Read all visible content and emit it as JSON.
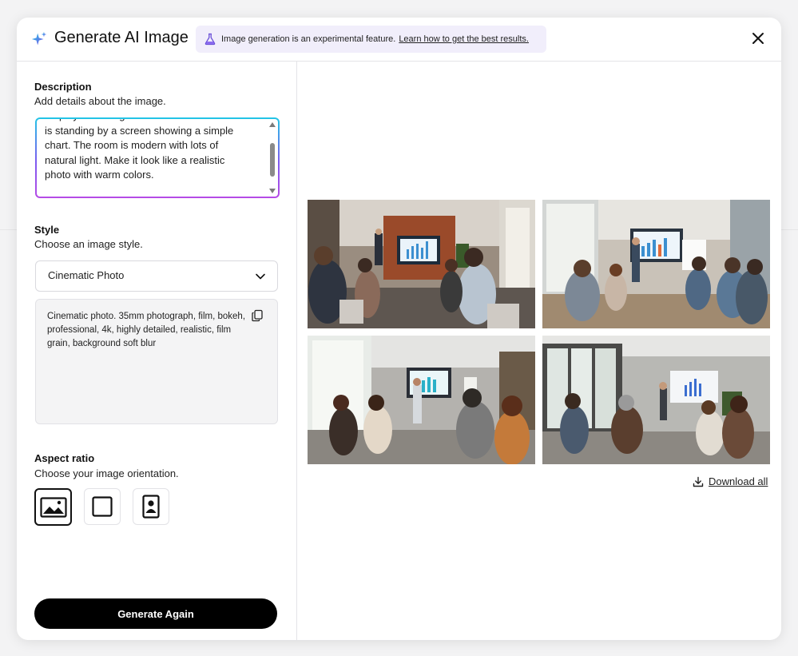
{
  "header": {
    "title": "Generate AI Image",
    "banner_text": "Image generation is an experimental feature.",
    "banner_link": "Learn how to get the best results."
  },
  "description": {
    "title": "Description",
    "subtitle": "Add details about the image.",
    "text": "employees sitting in a half-circle. The trainer\nis standing by a screen showing a simple\nchart. The room is modern with lots of\nnatural light. Make it look like a realistic\nphoto with warm colors."
  },
  "style": {
    "title": "Style",
    "subtitle": "Choose an image style.",
    "selected": "Cinematic Photo",
    "prompt": "Cinematic photo. 35mm photograph, film, bokeh, professional, 4k, highly detailed, realistic, film grain, background soft blur"
  },
  "aspect": {
    "title": "Aspect ratio",
    "subtitle": "Choose your image orientation.",
    "options": [
      "landscape",
      "square",
      "portrait"
    ],
    "selected": "landscape"
  },
  "actions": {
    "generate_label": "Generate Again",
    "download_label": "Download all"
  },
  "images": [
    {
      "name": "generated-image-1"
    },
    {
      "name": "generated-image-2"
    },
    {
      "name": "generated-image-3"
    },
    {
      "name": "generated-image-4"
    }
  ],
  "colors": {
    "accent_start": "#22c6e6",
    "accent_end": "#b64be6",
    "banner_bg": "#f1eefb",
    "button_bg": "#000000"
  }
}
